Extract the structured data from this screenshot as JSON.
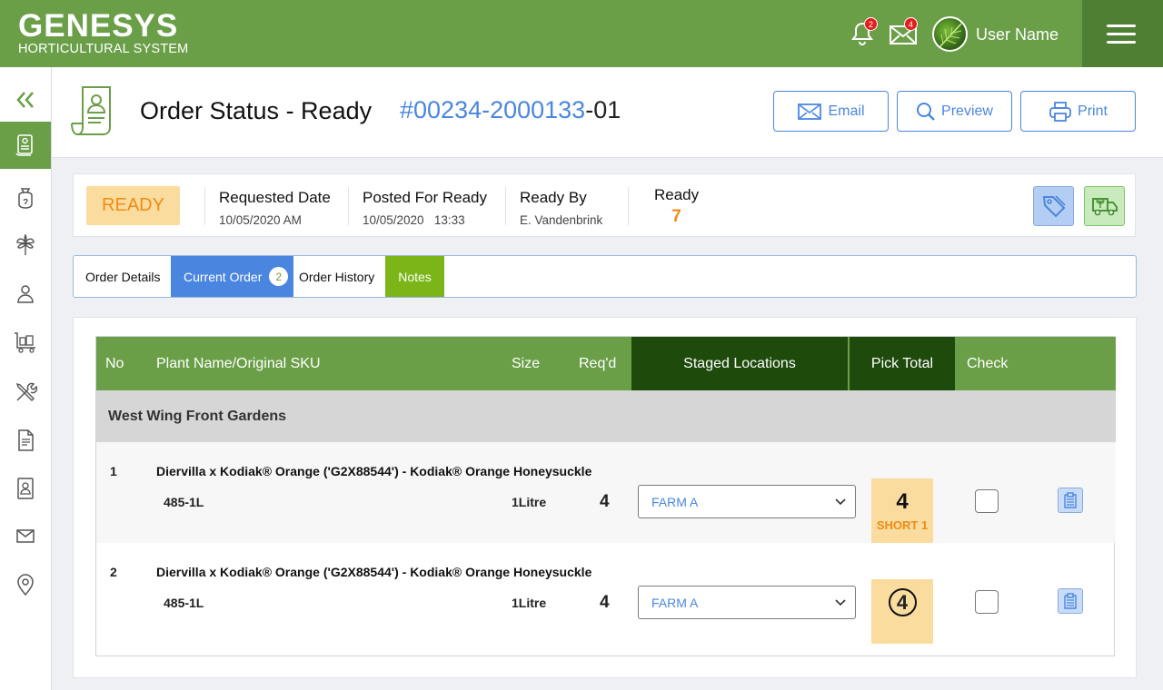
{
  "app": {
    "brand": "GENESYS",
    "subtitle": "HORTICULTURAL SYSTEM"
  },
  "topbar": {
    "notifications_count": "2",
    "messages_count": "4",
    "user_name": "User Name"
  },
  "sidebar": {
    "items": [
      {
        "icon": "collapse-icon"
      },
      {
        "icon": "order-list-icon",
        "active": true
      },
      {
        "icon": "bag-icon"
      },
      {
        "icon": "plant-icon"
      },
      {
        "icon": "user-icon"
      },
      {
        "icon": "cart-icon"
      },
      {
        "icon": "tools-icon"
      },
      {
        "icon": "document-icon"
      },
      {
        "icon": "contact-icon"
      },
      {
        "icon": "mail-icon"
      },
      {
        "icon": "location-icon"
      }
    ]
  },
  "header": {
    "title": "Order Status - Ready",
    "order_prefix": "#00234-2000133",
    "order_suffix": "-01",
    "buttons": {
      "email": "Email",
      "preview": "Preview",
      "print": "Print"
    }
  },
  "status": {
    "badge": "READY",
    "requested_label": "Requested Date",
    "requested_value": "10/05/2020 AM",
    "posted_label": "Posted For Ready",
    "posted_value": "10/05/2020   13:33",
    "ready_by_label": "Ready By",
    "ready_by_value": "E. Vandenbrink",
    "ready_label": "Ready",
    "ready_count": "7"
  },
  "tabs": {
    "order_details": "Order Details",
    "current_order": "Current Order",
    "current_order_count": "2",
    "order_history": "Order History",
    "notes": "Notes"
  },
  "table": {
    "headers": {
      "no": "No",
      "plant": "Plant Name/Original SKU",
      "size": "Size",
      "reqd": "Req'd",
      "staged": "Staged Locations",
      "pick_total": "Pick Total",
      "check": "Check"
    },
    "group": "West Wing Front Gardens",
    "rows": [
      {
        "no": "1",
        "plant": "Diervilla x Kodiak® Orange ('G2X88544') - Kodiak® Orange Honeysuckle",
        "sku": "485-1L",
        "size": "1Litre",
        "reqd": "4",
        "location": "FARM A",
        "pick": "4",
        "short": "SHORT 1",
        "checked": false
      },
      {
        "no": "2",
        "plant": "Diervilla x Kodiak® Orange ('G2X88544') - Kodiak® Orange Honeysuckle",
        "sku": "485-1L",
        "size": "1Litre",
        "reqd": "4",
        "location": "FARM A",
        "pick": "4",
        "checked": false
      }
    ]
  }
}
